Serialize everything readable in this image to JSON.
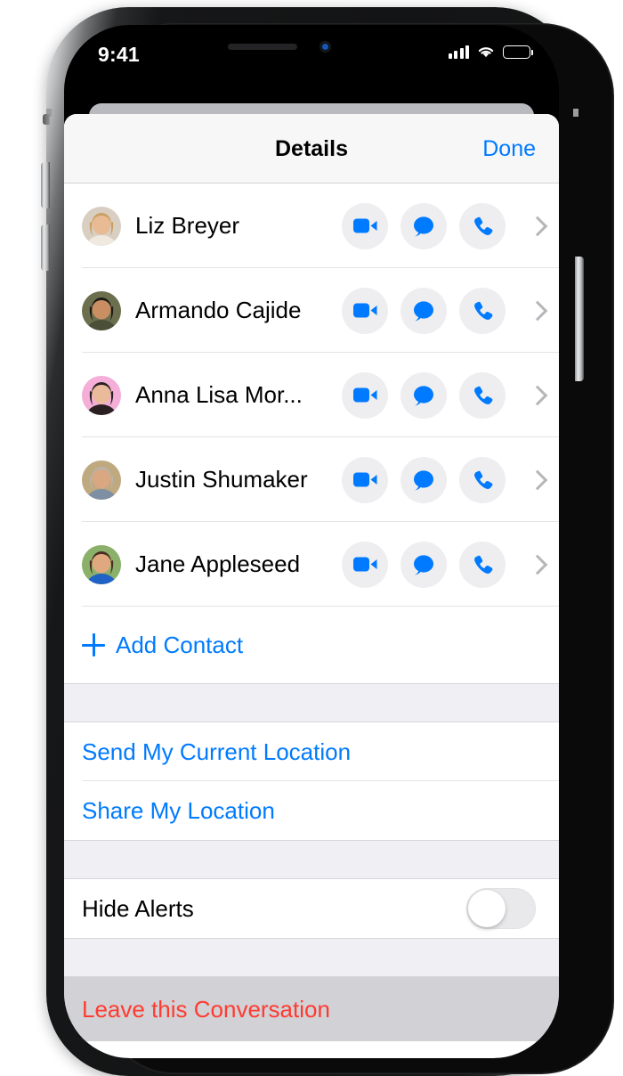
{
  "status_bar": {
    "time": "9:41",
    "signal_icon": "cellular-signal-icon",
    "wifi_icon": "wifi-icon",
    "battery_icon": "battery-full-icon"
  },
  "nav": {
    "title": "Details",
    "done_label": "Done"
  },
  "contacts": [
    {
      "name": "Liz Breyer",
      "avatar_bg": "#d8cfc2",
      "hair": "#c9a063",
      "skin": "#e8bb95",
      "clothes": "#efe9e0"
    },
    {
      "name": "Armando Cajide",
      "avatar_bg": "#6b6f4e",
      "hair": "#1d1a17",
      "skin": "#c98f63",
      "clothes": "#4b4f38"
    },
    {
      "name": "Anna Lisa Mor...",
      "avatar_bg": "#f4aed8",
      "hair": "#2a2022",
      "skin": "#e9bb9b",
      "clothes": "#2a2022"
    },
    {
      "name": "Justin Shumaker",
      "avatar_bg": "#bfa97f",
      "hair": "#b9b2a6",
      "skin": "#d9a782",
      "clothes": "#7f8fa3"
    },
    {
      "name": "Jane Appleseed",
      "avatar_bg": "#8ab06a",
      "hair": "#4a2d21",
      "skin": "#e0a87f",
      "clothes": "#1f61c4"
    }
  ],
  "row_actions": {
    "facetime_icon": "video-camera-icon",
    "message_icon": "message-bubble-icon",
    "call_icon": "phone-handset-icon",
    "disclosure_icon": "chevron-right-icon"
  },
  "add_contact": {
    "label": "Add Contact",
    "icon": "plus-icon"
  },
  "location": {
    "send_label": "Send My Current Location",
    "share_label": "Share My Location"
  },
  "hide_alerts": {
    "label": "Hide Alerts",
    "value": "off"
  },
  "leave": {
    "label": "Leave this Conversation"
  },
  "colors": {
    "accent_blue": "#007aff",
    "destructive_red": "#ff3b30",
    "group_background": "#efeff4",
    "action_circle": "#eeeef1"
  }
}
